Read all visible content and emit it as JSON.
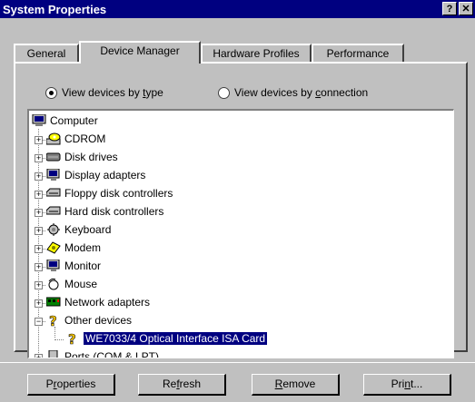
{
  "window": {
    "title": "System Properties",
    "help_glyph": "?",
    "close_glyph": "✕"
  },
  "tabs": [
    {
      "label": "General"
    },
    {
      "label": "Device Manager"
    },
    {
      "label": "Hardware Profiles"
    },
    {
      "label": "Performance"
    }
  ],
  "view_options": {
    "by_type": {
      "label_pre": "View devices by ",
      "label_u": "t",
      "label_post": "ype",
      "selected": true
    },
    "by_connection": {
      "label_pre": "View devices by ",
      "label_u": "c",
      "label_post": "onnection",
      "selected": false
    }
  },
  "tree": {
    "root": "Computer",
    "items": [
      {
        "label": "CDROM",
        "icon": "cdrom-icon"
      },
      {
        "label": "Disk drives",
        "icon": "disk-drive-icon"
      },
      {
        "label": "Display adapters",
        "icon": "monitor-icon"
      },
      {
        "label": "Floppy disk controllers",
        "icon": "floppy-controller-icon"
      },
      {
        "label": "Hard disk controllers",
        "icon": "hdd-controller-icon"
      },
      {
        "label": "Keyboard",
        "icon": "keyboard-icon"
      },
      {
        "label": "Modem",
        "icon": "modem-icon"
      },
      {
        "label": "Monitor",
        "icon": "monitor-icon"
      },
      {
        "label": "Mouse",
        "icon": "mouse-icon"
      },
      {
        "label": "Network adapters",
        "icon": "network-adapter-icon"
      },
      {
        "label": "Other devices",
        "icon": "question-icon"
      },
      {
        "label": "WE7033/4 Optical Interface ISA Card",
        "icon": "question-icon"
      },
      {
        "label": "Ports (COM & LPT)",
        "icon": "port-icon"
      }
    ]
  },
  "buttons": {
    "properties": {
      "pre": "P",
      "u": "r",
      "post": "operties"
    },
    "refresh": {
      "pre": "Re",
      "u": "f",
      "post": "resh"
    },
    "remove": {
      "pre": "",
      "u": "R",
      "post": "emove"
    },
    "print": {
      "pre": "Pri",
      "u": "n",
      "post": "t..."
    }
  },
  "colors": {
    "titlebar": "#000080",
    "face": "#c0c0c0",
    "selection": "#000080"
  }
}
